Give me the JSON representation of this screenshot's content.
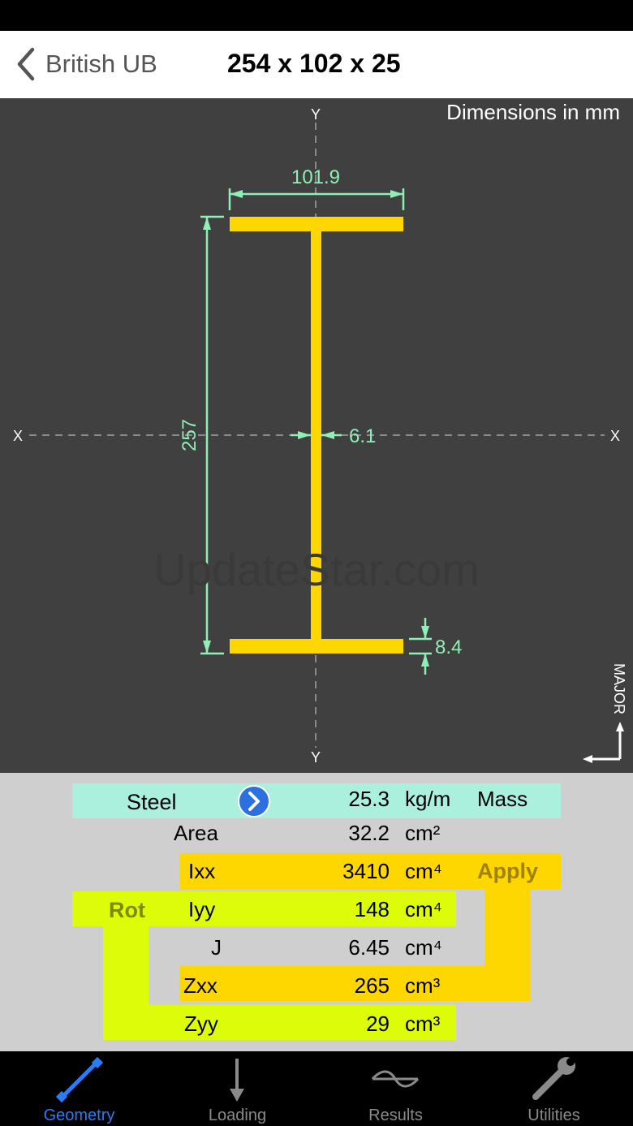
{
  "nav": {
    "back_label": "British UB",
    "title": "254 x 102 x 25"
  },
  "drawing": {
    "note": "Dimensions in mm",
    "axis_y_top": "Y",
    "axis_y_bottom": "Y",
    "axis_x_left": "X",
    "axis_x_right": "X",
    "dim_width": "101.9",
    "dim_depth": "257",
    "dim_web": "6.1",
    "dim_flange": "8.4",
    "orientation": "MAJOR",
    "watermark": "UpdateStar.com",
    "colors": {
      "section": "#ffd700",
      "dimension": "#8ef0b4",
      "background": "#404040"
    }
  },
  "props": {
    "material": "Steel",
    "mass": {
      "value": "25.3",
      "unit": "kg/m",
      "label": "Mass"
    },
    "area": {
      "label": "Area",
      "value": "32.2",
      "unit": "cm²"
    },
    "ixx": {
      "label": "Ixx",
      "value": "3410",
      "unit": "cm⁴"
    },
    "iyy": {
      "label": "Iyy",
      "value": "148",
      "unit": "cm⁴"
    },
    "j": {
      "label": "J",
      "value": "6.45",
      "unit": "cm⁴"
    },
    "zxx": {
      "label": "Zxx",
      "value": "265",
      "unit": "cm³"
    },
    "zyy": {
      "label": "Zyy",
      "value": "29",
      "unit": "cm³"
    },
    "apply_label": "Apply",
    "rot_label": "Rot",
    "colors": {
      "cyan": "#aaf0dc",
      "yellow": "#ffd700",
      "lime": "#ddfc0a",
      "panel": "#cfcfcf"
    }
  },
  "tabs": [
    {
      "label": "Geometry",
      "icon": "geometry-icon",
      "active": true
    },
    {
      "label": "Loading",
      "icon": "loading-arrow-icon",
      "active": false
    },
    {
      "label": "Results",
      "icon": "results-wave-icon",
      "active": false
    },
    {
      "label": "Utilities",
      "icon": "wrench-icon",
      "active": false
    }
  ],
  "accent_color": "#2a7cf6"
}
